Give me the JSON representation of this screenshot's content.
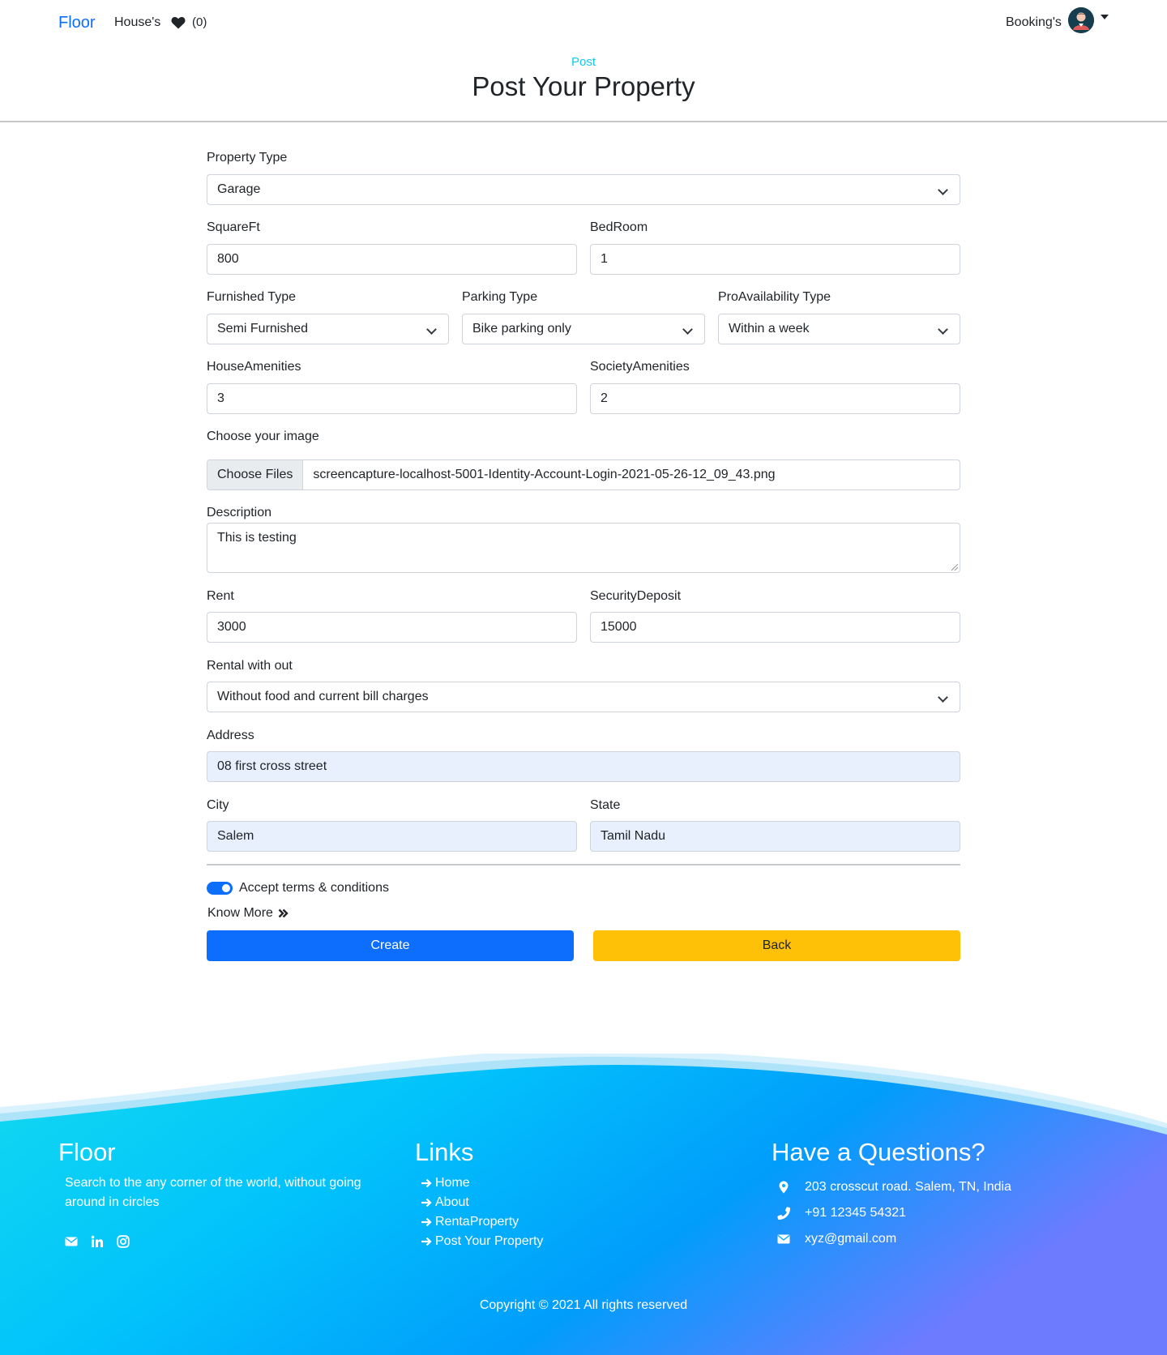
{
  "nav": {
    "brand": "Floor",
    "houses": "House's",
    "favorites_count": "(0)",
    "bookings": "Booking's"
  },
  "header": {
    "subtitle": "Post",
    "title": "Post Your Property"
  },
  "form": {
    "property_type": {
      "label": "Property Type",
      "value": "Garage"
    },
    "square_ft": {
      "label": "SquareFt",
      "value": "800"
    },
    "bedroom": {
      "label": "BedRoom",
      "value": "1"
    },
    "furnished_type": {
      "label": "Furnished Type",
      "value": "Semi Furnished"
    },
    "parking_type": {
      "label": "Parking Type",
      "value": "Bike parking only"
    },
    "availability_type": {
      "label": "ProAvailability Type",
      "value": "Within a week"
    },
    "house_amenities": {
      "label": "HouseAmenities",
      "value": "3"
    },
    "society_amenities": {
      "label": "SocietyAmenities",
      "value": "2"
    },
    "image": {
      "label": "Choose your image",
      "button": "Choose Files",
      "file_name": "screencapture-localhost-5001-Identity-Account-Login-2021-05-26-12_09_43.png"
    },
    "description": {
      "label": "Description",
      "value": "This is testing"
    },
    "rent": {
      "label": "Rent",
      "value": "3000"
    },
    "security_deposit": {
      "label": "SecurityDeposit",
      "value": "15000"
    },
    "rental_without": {
      "label": "Rental with out",
      "value": "Without food and current bill charges"
    },
    "address": {
      "label": "Address",
      "value": "08 first cross street"
    },
    "city": {
      "label": "City",
      "value": "Salem"
    },
    "state": {
      "label": "State",
      "value": "Tamil Nadu"
    },
    "terms": {
      "label": "Accept terms & conditions",
      "checked": true
    },
    "know_more": "Know More",
    "create_button": "Create",
    "back_button": "Back"
  },
  "footer": {
    "brand": "Floor",
    "tagline": "Search to the any corner of the world, without going around in circles",
    "social_icons": [
      "envelope-icon",
      "linkedin-icon",
      "instagram-icon"
    ],
    "links_title": "Links",
    "links": [
      "Home",
      "About",
      "RentaProperty",
      "Post Your Property"
    ],
    "contact_title": "Have a Questions?",
    "address": "203 crosscut road. Salem, TN, India",
    "phone": "+91 12345 54321",
    "email": "xyz@gmail.com",
    "copyright": "Copyright © 2021 All rights reserved"
  },
  "colors": {
    "primary": "#0d6efd",
    "warning": "#ffc107",
    "info": "#0dcaf0",
    "footer_start": "#12d8f0",
    "footer_end": "#6c7bff"
  }
}
